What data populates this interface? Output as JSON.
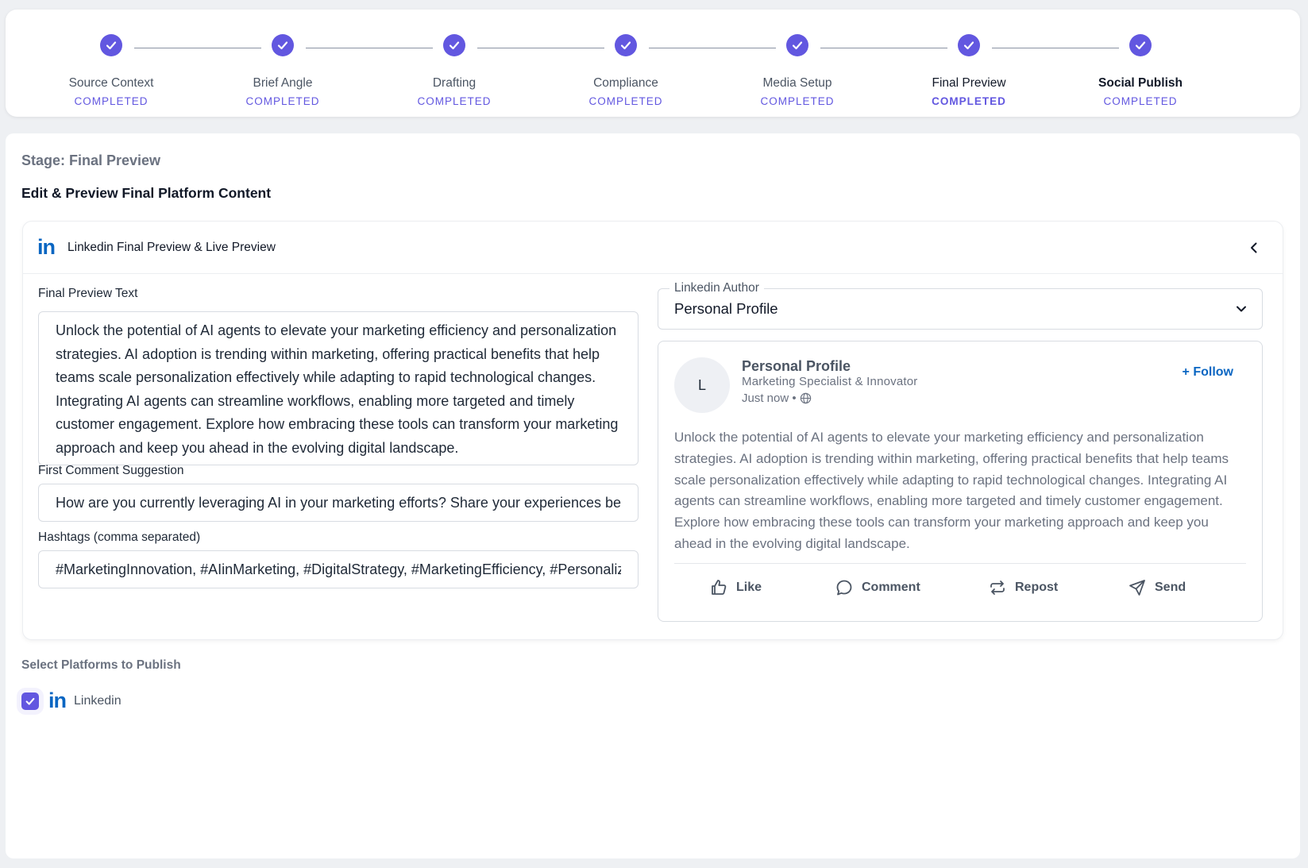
{
  "stepper": {
    "steps": [
      {
        "label": "Source Context",
        "status": "COMPLETED"
      },
      {
        "label": "Brief Angle",
        "status": "COMPLETED"
      },
      {
        "label": "Drafting",
        "status": "COMPLETED"
      },
      {
        "label": "Compliance",
        "status": "COMPLETED"
      },
      {
        "label": "Media Setup",
        "status": "COMPLETED"
      },
      {
        "label": "Final Preview",
        "status": "COMPLETED"
      },
      {
        "label": "Social Publish",
        "status": "COMPLETED"
      }
    ]
  },
  "main": {
    "stage_label": "Stage: Final Preview",
    "section_title": "Edit & Preview Final Platform Content"
  },
  "platform_card": {
    "icon": "linkedin-icon",
    "logo_text": "in",
    "title": "Linkedin Final Preview & Live Preview",
    "final_preview_label": "Final Preview Text",
    "final_preview_text": "Unlock the potential of AI agents to elevate your marketing efficiency and personalization strategies. AI adoption is trending within marketing, offering practical benefits that help teams scale personalization effectively while adapting to rapid technological changes. Integrating AI agents can streamline workflows, enabling more targeted and timely customer engagement. Explore how embracing these tools can transform your marketing approach and keep you ahead in the evolving digital landscape.",
    "first_comment_label": "First Comment Suggestion",
    "first_comment_value": "How are you currently leveraging AI in your marketing efforts? Share your experiences below!",
    "hashtags_label": "Hashtags (comma separated)",
    "hashtags_value": "#MarketingInnovation, #AIinMarketing, #DigitalStrategy, #MarketingEfficiency, #Personalization",
    "author": {
      "legend": "Linkedin Author",
      "value": "Personal Profile"
    },
    "preview": {
      "avatar_initial": "L",
      "name": "Personal Profile",
      "subtitle": "Marketing Specialist & Innovator",
      "time": "Just now •",
      "follow_label": "+ Follow",
      "body": "Unlock the potential of AI agents to elevate your marketing efficiency and personalization strategies. AI adoption is trending within marketing, offering practical benefits that help teams scale personalization effectively while adapting to rapid technological changes. Integrating AI agents can streamline workflows, enabling more targeted and timely customer engagement. Explore how embracing these tools can transform your marketing approach and keep you ahead in the evolving digital landscape.",
      "actions": {
        "like": "Like",
        "comment": "Comment",
        "repost": "Repost",
        "send": "Send"
      }
    }
  },
  "publish": {
    "label": "Select Platforms to Publish",
    "platform": "Linkedin",
    "checked": true
  },
  "colors": {
    "accent": "#6257e0",
    "linkedin": "#0a66c2"
  }
}
